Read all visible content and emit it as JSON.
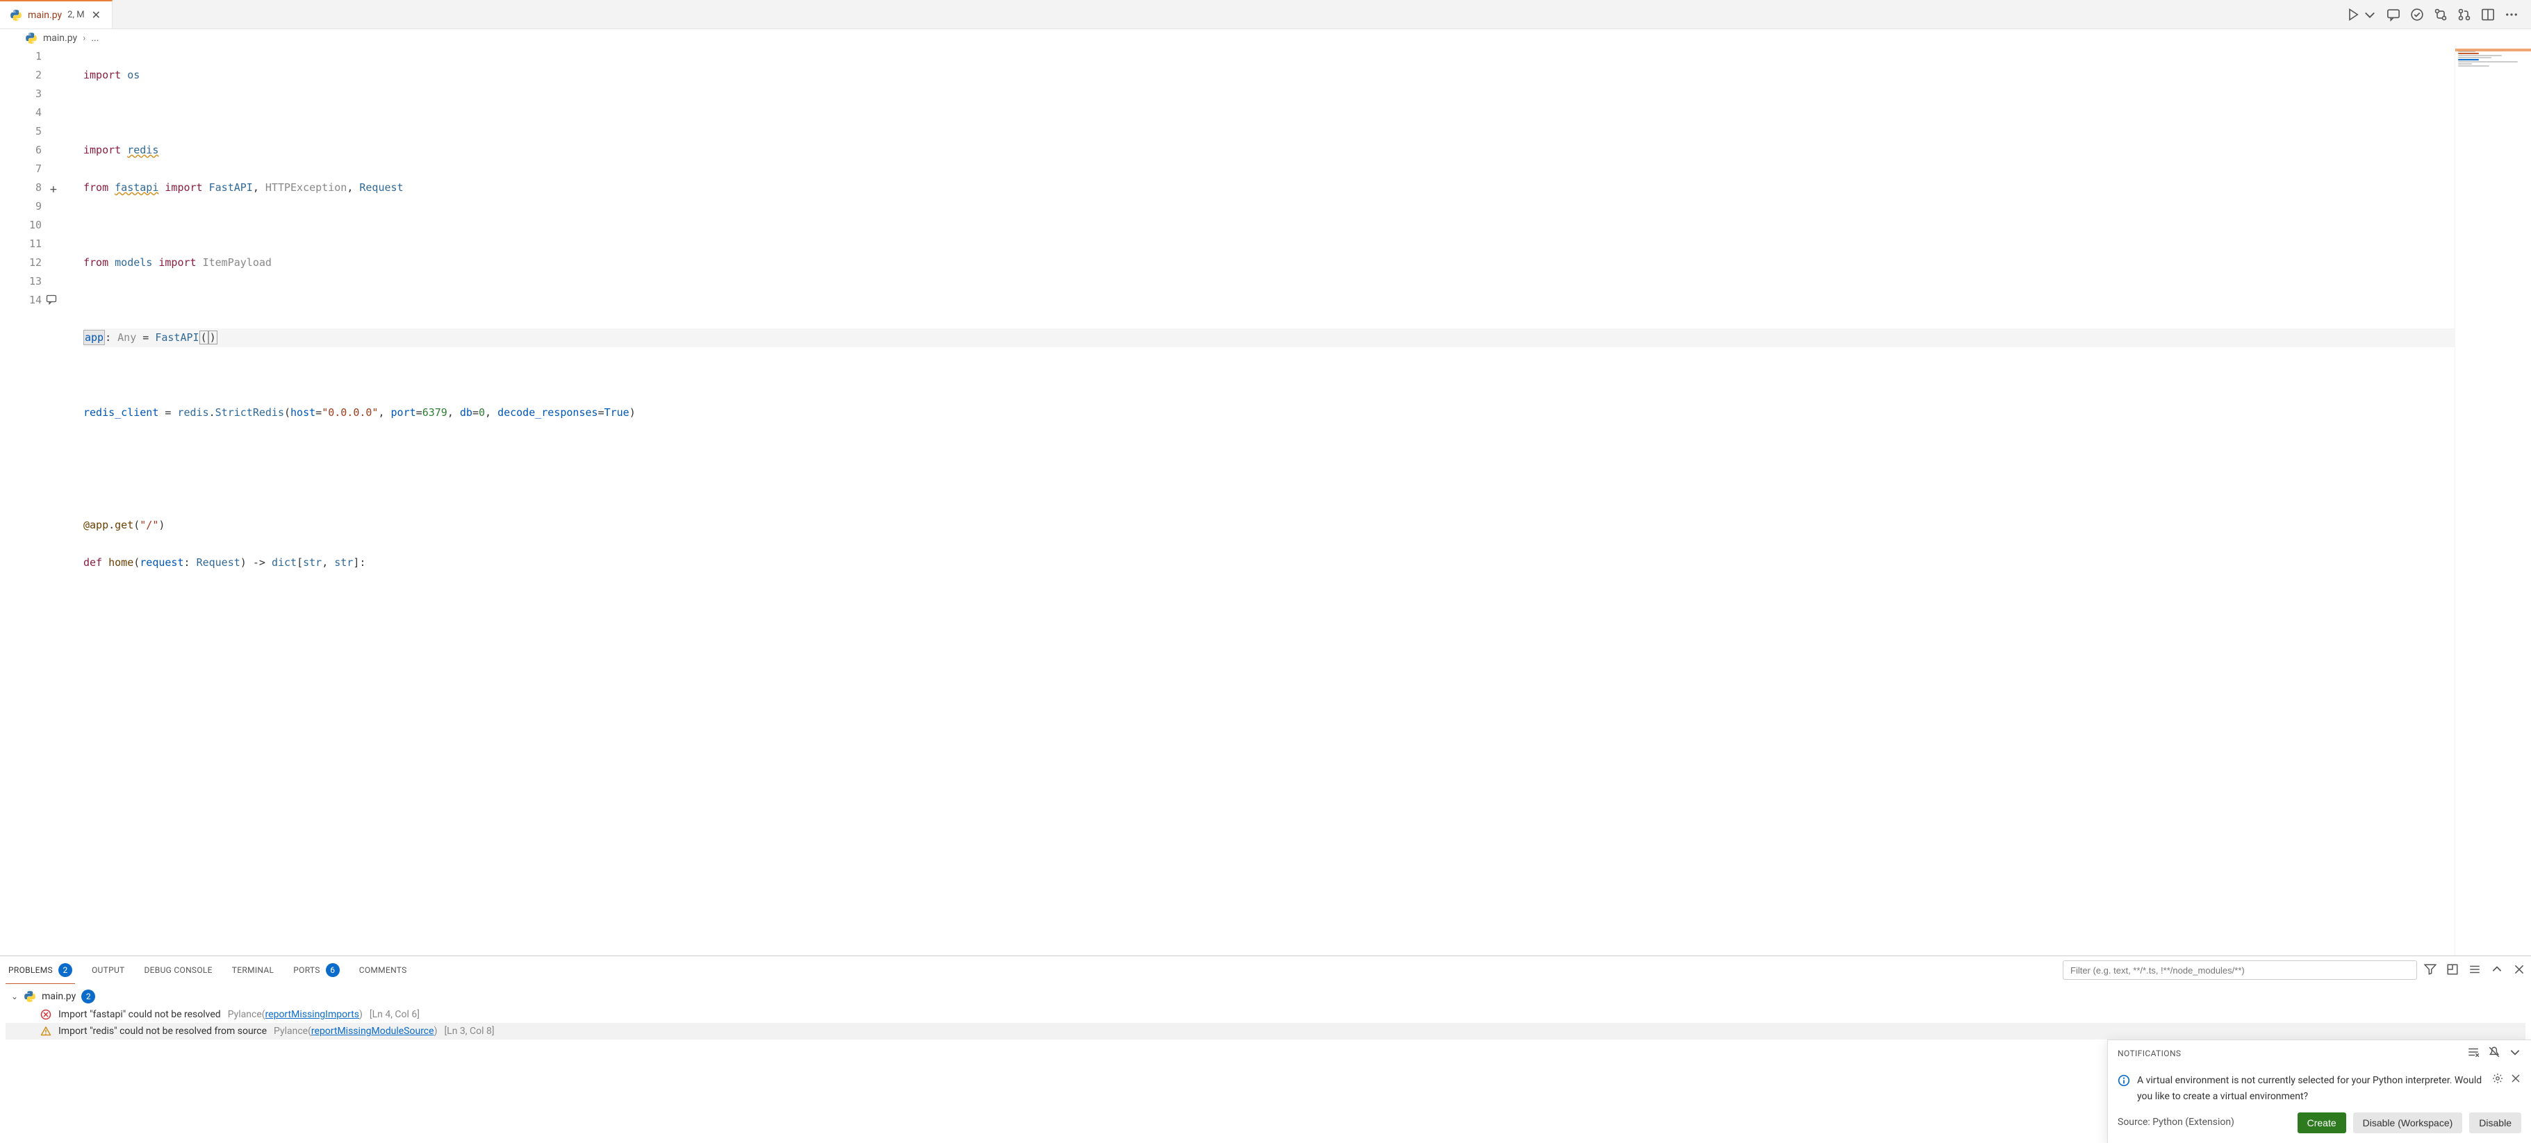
{
  "tab": {
    "filename": "main.py",
    "badge": "2, M"
  },
  "breadcrumb": {
    "filename": "main.py",
    "more": "..."
  },
  "tabbar_icons": {
    "run": "run-icon",
    "chevron": "chevron-down-icon",
    "comment": "comment-icon",
    "check": "check-icon",
    "branch": "branch-compare-icon",
    "diff": "git-pr-icon",
    "split": "split-editor-icon",
    "more": "more-icon"
  },
  "editor": {
    "gutter": [
      "1",
      "2",
      "3",
      "4",
      "5",
      "6",
      "7",
      "8",
      "9",
      "10",
      "11",
      "12",
      "13",
      "14"
    ],
    "highlighted_line_index": 7,
    "comment_gutter_line": 14,
    "plus_gutter_line": 8,
    "tokens": {
      "import": "import",
      "os": "os",
      "redis": "redis",
      "from": "from",
      "fastapi": "fastapi",
      "FastAPI": "FastAPI",
      "HTTPException": "HTTPException",
      "Request": "Request",
      "models": "models",
      "ItemPayload": "ItemPayload",
      "app": "app",
      "Any": "Any",
      "redis_client": "redis_client",
      "StrictRedis": "StrictRedis",
      "host": "host",
      "host_val": "\"0.0.0.0\"",
      "port": "port",
      "port_val": "6379",
      "db": "db",
      "db_val": "0",
      "decode_responses": "decode_responses",
      "True": "True",
      "at_app_get": "@app",
      "get": "get",
      "route": "\"/\"",
      "def": "def",
      "home": "home",
      "request": "request",
      "arrow": "->",
      "dict": "dict",
      "str": "str"
    }
  },
  "panel": {
    "tabs": {
      "problems": "PROBLEMS",
      "problems_count": "2",
      "output": "OUTPUT",
      "debug_console": "DEBUG CONSOLE",
      "terminal": "TERMINAL",
      "ports": "PORTS",
      "ports_count": "6",
      "comments": "COMMENTS"
    },
    "filter_placeholder": "Filter (e.g. text, **/*.ts, !**/node_modules/**)",
    "file": {
      "name": "main.py",
      "count": "2"
    },
    "problems": [
      {
        "severity": "error",
        "message": "Import \"fastapi\" could not be resolved",
        "source": "Pylance",
        "link": "reportMissingImports",
        "location": "[Ln 4, Col 6]"
      },
      {
        "severity": "warning",
        "message": "Import \"redis\" could not be resolved from source",
        "source": "Pylance",
        "link": "reportMissingModuleSource",
        "location": "[Ln 3, Col 8]"
      }
    ]
  },
  "notification": {
    "header": "NOTIFICATIONS",
    "message": "A virtual environment is not currently selected for your Python interpreter. Would you like to create a virtual environment?",
    "source": "Source: Python (Extension)",
    "buttons": {
      "create": "Create",
      "disable_ws": "Disable (Workspace)",
      "disable": "Disable"
    }
  }
}
